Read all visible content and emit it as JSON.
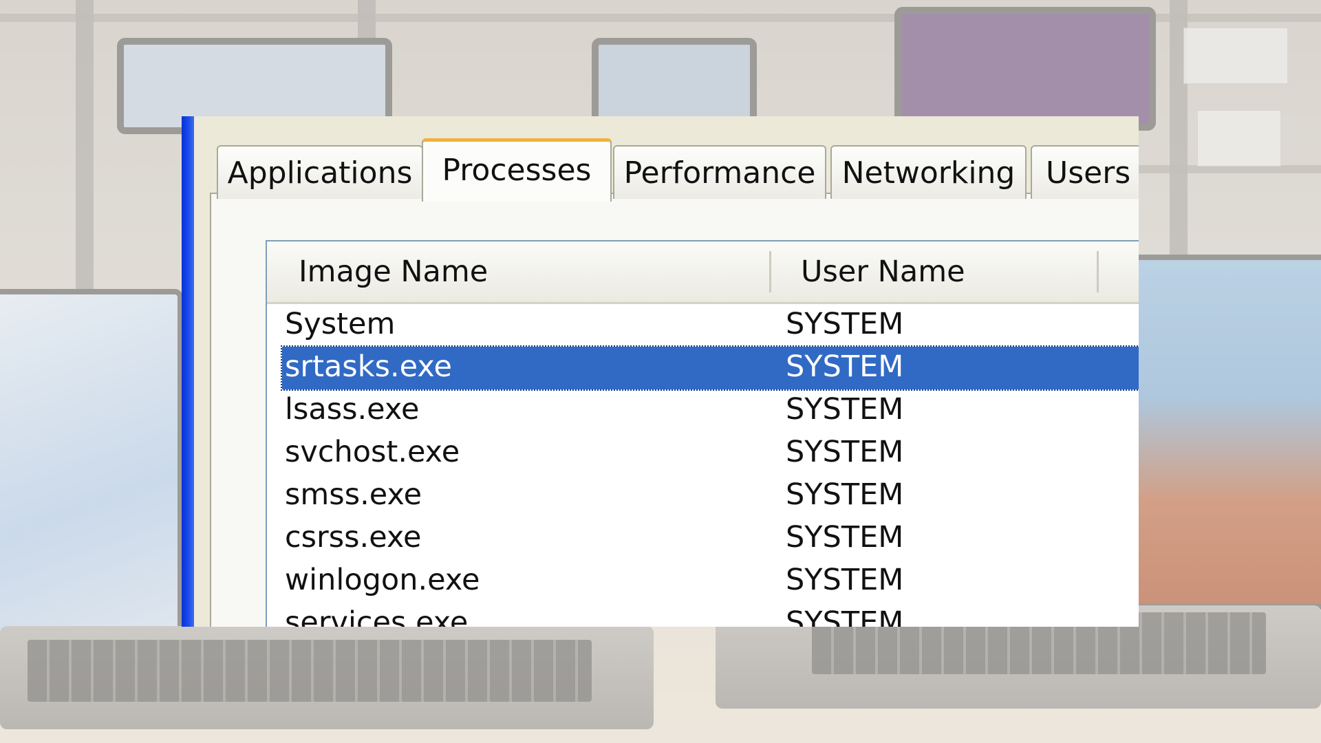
{
  "tabs": [
    {
      "label": "Applications",
      "active": false
    },
    {
      "label": "Processes",
      "active": true
    },
    {
      "label": "Performance",
      "active": false
    },
    {
      "label": "Networking",
      "active": false
    },
    {
      "label": "Users",
      "active": false
    }
  ],
  "columns": {
    "image_name": "Image Name",
    "user_name": "User Name"
  },
  "processes": [
    {
      "image": "System",
      "user": "SYSTEM"
    },
    {
      "image": "srtasks.exe",
      "user": "SYSTEM",
      "selected": true
    },
    {
      "image": "lsass.exe",
      "user": "SYSTEM"
    },
    {
      "image": "svchost.exe",
      "user": "SYSTEM"
    },
    {
      "image": "smss.exe",
      "user": "SYSTEM"
    },
    {
      "image": "csrss.exe",
      "user": "SYSTEM"
    },
    {
      "image": "winlogon.exe",
      "user": "SYSTEM"
    },
    {
      "image": "services.exe",
      "user": "SYSTEM"
    }
  ],
  "colors": {
    "selection": "#316ac5",
    "active_tab_accent": "#f0b23a",
    "window_frame": "#0831d9"
  }
}
